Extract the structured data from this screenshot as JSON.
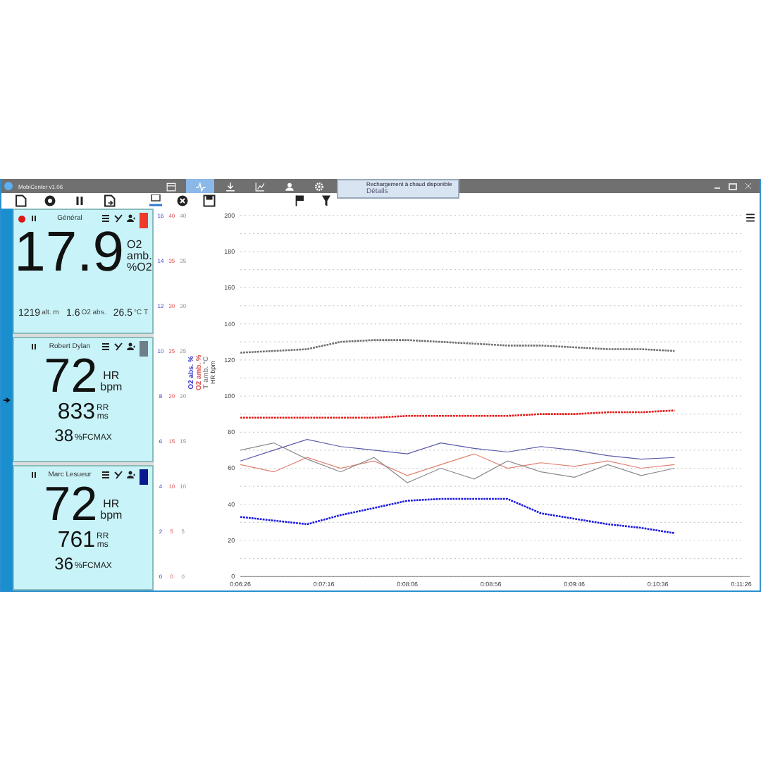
{
  "window": {
    "title": "MobiCenter v1.06"
  },
  "nav_tabs": [
    {
      "kind": "calendar",
      "selected": false
    },
    {
      "kind": "heartbeat",
      "selected": true
    },
    {
      "kind": "download",
      "selected": false
    },
    {
      "kind": "chart",
      "selected": false
    },
    {
      "kind": "person",
      "selected": false
    },
    {
      "kind": "settings",
      "selected": false
    }
  ],
  "notice": {
    "title": "Rechargement à chaud disponible",
    "note": "Détails"
  },
  "toolbar_left": [
    {
      "kind": "new"
    },
    {
      "kind": "record"
    },
    {
      "kind": "pause"
    },
    {
      "kind": "export"
    }
  ],
  "toolbar_right": [
    {
      "kind": "monitor"
    },
    {
      "kind": "cancel"
    },
    {
      "kind": "save"
    },
    {
      "kind": "flag"
    },
    {
      "kind": "filter"
    }
  ],
  "cards": [
    {
      "name": "Général",
      "recording": true,
      "color": "#ee3b2b",
      "main": {
        "value": "17.9",
        "unit_top": "O2 amb.",
        "unit_bottom": "%O2"
      },
      "extras": [
        {
          "value": "1219",
          "unit": "alt. m"
        },
        {
          "value": "1.6",
          "unit": "O2 abs."
        },
        {
          "value": "26.5",
          "unit": "°C T"
        }
      ]
    },
    {
      "name": "Robert Dylan",
      "recording": false,
      "color": "#6d7f88",
      "main": {
        "value": "72",
        "unit_top": "HR",
        "unit_bottom": "bpm"
      },
      "rows": [
        {
          "value": "833",
          "unit_top": "RR",
          "unit_bottom": "ms"
        },
        {
          "value": "38",
          "unit_top": "",
          "unit_bottom": "%FCMAX"
        }
      ]
    },
    {
      "name": "Marc Lesueur",
      "recording": false,
      "color": "#0b1a8e",
      "main": {
        "value": "72",
        "unit_top": "HR",
        "unit_bottom": "bpm"
      },
      "rows": [
        {
          "value": "761",
          "unit_top": "RR",
          "unit_bottom": "ms"
        },
        {
          "value": "36",
          "unit_top": "",
          "unit_bottom": "%FCMAX"
        }
      ]
    }
  ],
  "extra_axes": [
    {
      "title": "O2 abs. %",
      "color": "#3a3ad0",
      "ticks": [
        "16",
        "14",
        "12",
        "10",
        "8",
        "6",
        "4",
        "2",
        "0"
      ]
    },
    {
      "title": "O2 amb. %",
      "color": "#e05050",
      "ticks": [
        "40",
        "35",
        "30",
        "25",
        "20",
        "15",
        "10",
        "5",
        "0"
      ]
    },
    {
      "title": "T amb. °C",
      "color": "#909090",
      "ticks": [
        "40",
        "35",
        "30",
        "25",
        "20",
        "15",
        "10",
        "5",
        "0"
      ]
    }
  ],
  "chart": {
    "chart_data": {
      "type": "line",
      "ylabel": "HR bpm",
      "grid": true,
      "x": [
        386,
        406,
        426,
        446,
        466,
        486,
        506,
        526,
        546,
        566,
        586,
        606,
        626,
        646
      ],
      "xlim": [
        386,
        686
      ],
      "ylim": [
        0,
        200
      ],
      "xticks": [
        {
          "value": 386,
          "label": "0:06:26"
        },
        {
          "value": 436,
          "label": "0:07:16"
        },
        {
          "value": 486,
          "label": "0:08:06"
        },
        {
          "value": 536,
          "label": "0:08:56"
        },
        {
          "value": 586,
          "label": "0:09:46"
        },
        {
          "value": 636,
          "label": "0:10:36"
        },
        {
          "value": 686,
          "label": "0:11:26"
        }
      ],
      "yticks": [
        0,
        20,
        40,
        60,
        80,
        100,
        120,
        140,
        160,
        180,
        200
      ],
      "series": [
        {
          "color": "#707070",
          "line_style": "dotted",
          "values": [
            124,
            125,
            126,
            130,
            131,
            131,
            130,
            129,
            128,
            128,
            127,
            126,
            126,
            125
          ]
        },
        {
          "color": "#e81818",
          "line_style": "dotted",
          "values": [
            88,
            88,
            88,
            88,
            88,
            89,
            89,
            89,
            89,
            90,
            90,
            91,
            91,
            92
          ]
        },
        {
          "color": "#1a1ae0",
          "line_style": "dotted",
          "values": [
            33,
            31,
            29,
            34,
            38,
            42,
            43,
            43,
            43,
            35,
            32,
            29,
            27,
            24
          ]
        },
        {
          "color": "#5a5aa8",
          "line_style": "solid",
          "values": [
            64,
            70,
            76,
            72,
            70,
            68,
            74,
            71,
            69,
            72,
            70,
            67,
            65,
            66
          ]
        },
        {
          "color": "#e08070",
          "line_style": "solid",
          "values": [
            62,
            58,
            66,
            60,
            64,
            56,
            62,
            68,
            60,
            63,
            61,
            64,
            60,
            62
          ]
        },
        {
          "color": "#8a8a8a",
          "line_style": "solid",
          "values": [
            70,
            74,
            65,
            58,
            66,
            52,
            60,
            54,
            64,
            58,
            55,
            62,
            56,
            60
          ]
        }
      ]
    }
  }
}
